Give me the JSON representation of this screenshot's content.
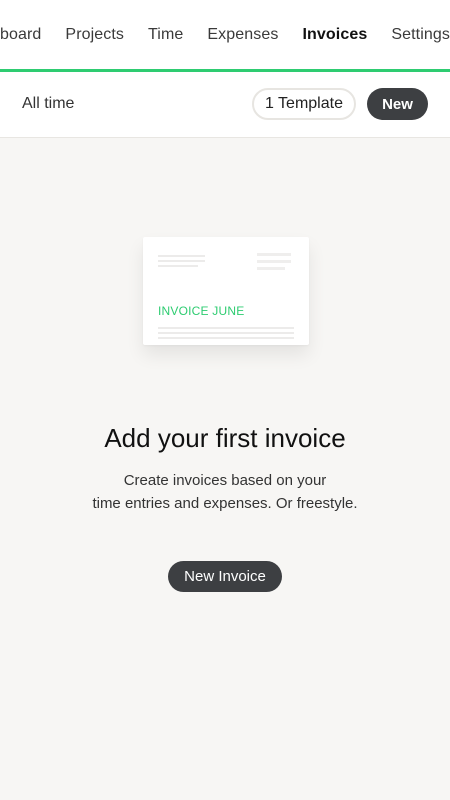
{
  "nav": {
    "tabs": [
      {
        "label": "board"
      },
      {
        "label": "Projects"
      },
      {
        "label": "Time"
      },
      {
        "label": "Expenses"
      },
      {
        "label": "Invoices"
      },
      {
        "label": "Settings"
      }
    ],
    "active_tab": "Invoices",
    "accent_color": "#2ecc71"
  },
  "toolbar": {
    "filter_label": "All time",
    "template_label": "1 Template",
    "new_label": "New"
  },
  "illustration": {
    "title": "INVOICE JUNE"
  },
  "empty_state": {
    "title": "Add your first invoice",
    "description_line1": "Create invoices based on your",
    "description_line2": "time entries and expenses. Or freestyle.",
    "button_label": "New Invoice"
  },
  "colors": {
    "button_dark": "#3d3f42",
    "background": "#f7f6f4"
  }
}
